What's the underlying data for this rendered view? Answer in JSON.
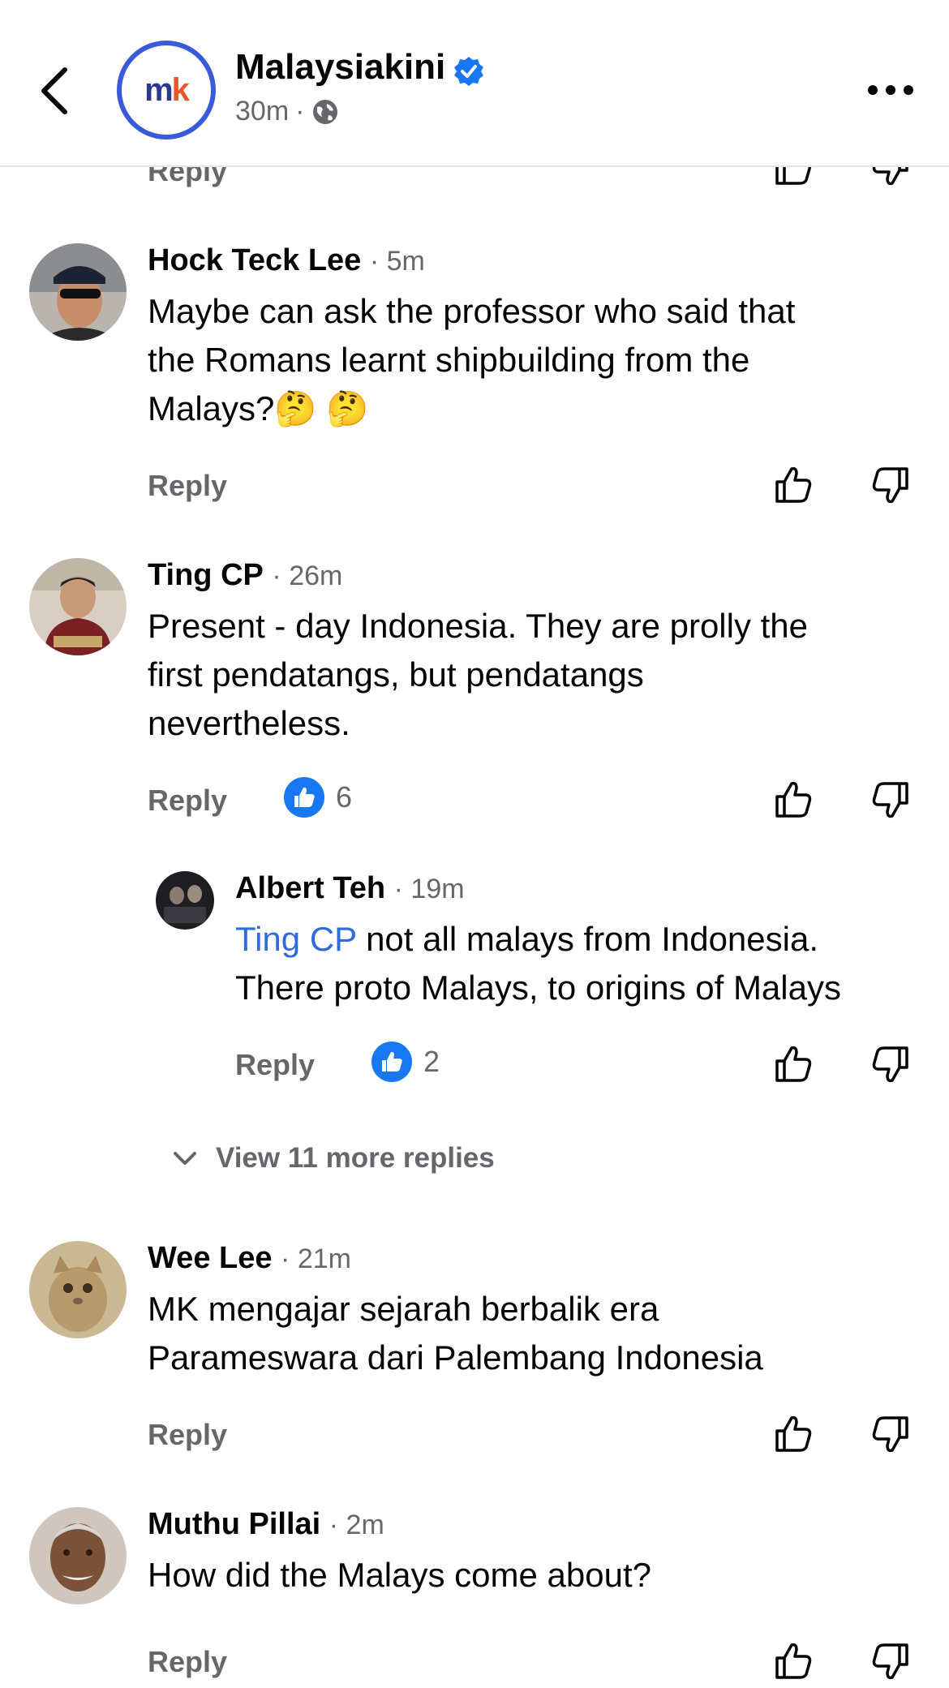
{
  "header": {
    "page_name": "Malaysiakini",
    "time": "30m",
    "separator": "·",
    "logo_m": "m",
    "logo_k": "k",
    "colors": {
      "logo_ring": "#3a5bd9",
      "logo_m": "#2b3a8c",
      "logo_k": "#e8562a",
      "verified": "#1877f2"
    }
  },
  "partial": {
    "reply_label": "Reply"
  },
  "comments": [
    {
      "name": "Hock Teck Lee",
      "time": "· 5m",
      "text_lines": [
        "Maybe can ask the professor who said that",
        "the Romans learnt shipbuilding from the",
        "Malays?🤔 🤔"
      ],
      "reply_label": "Reply"
    },
    {
      "name": "Ting CP",
      "time": "· 26m",
      "text_lines": [
        "Present - day Indonesia. They are prolly the",
        "first pendatangs, but pendatangs",
        "nevertheless."
      ],
      "reply_label": "Reply",
      "reactions": "6"
    },
    {
      "name": "Albert Teh",
      "time": "· 19m",
      "mention": "Ting CP",
      "text_line1_rest": " not all malays from Indonesia.",
      "text_line2": "There proto Malays, to origins of Malays",
      "reply_label": "Reply",
      "reactions": "2"
    },
    {
      "name": "Wee Lee",
      "time": "· 21m",
      "text_lines": [
        "MK mengajar sejarah berbalik era",
        "Parameswara dari Palembang Indonesia"
      ],
      "reply_label": "Reply"
    },
    {
      "name": "Muthu Pillai",
      "time": "· 2m",
      "text_lines": [
        "How did the Malays come about?"
      ],
      "reply_label": "Reply"
    }
  ],
  "view_more_replies": "View 11 more replies",
  "icons": [
    "back-arrow-icon",
    "verified-badge-icon",
    "globe-icon",
    "more-icon",
    "thumbs-up-icon",
    "thumbs-down-icon",
    "like-reaction-icon",
    "chevron-down-icon"
  ]
}
